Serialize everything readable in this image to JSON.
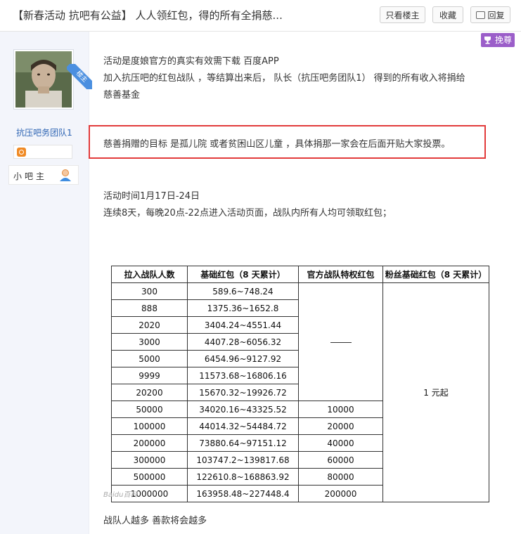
{
  "header": {
    "title": "【新春活动 抗吧有公益】 人人领红包，得的所有全捐慈...",
    "btn_only_op": "只看楼主",
    "btn_favorite": "收藏",
    "btn_reply": "回复"
  },
  "author": {
    "floor_badge": "楼主",
    "username": "抗压吧务团队1",
    "role": "小吧主"
  },
  "post_badge": "挽尊",
  "post": {
    "line1": "活动是度娘官方的真实有效需下载 百度APP",
    "line2": "加入抗压吧的红包战队 ，等结算出来后， 队长（抗压吧务团队1） 得到的所有收入将捐给",
    "line3": "慈善基金",
    "highlight": "慈善捐赠的目标 是孤儿院 或者贫困山区儿童 ，具体捐那一家会在后面开贴大家投票。",
    "time": "活动时间1月17日-24日",
    "rule": "连续8天，每晚20点-22点进入活动页面，战队内所有人均可领取红包；",
    "footer": "战队人越多 善款将会越多"
  },
  "table": {
    "headers": [
      "拉入战队人数",
      "基础红包（8 天累计）",
      "官方战队特权红包",
      "粉丝基础红包（8 天累计）"
    ],
    "rows": [
      [
        "300",
        "589.6~748.24",
        ""
      ],
      [
        "888",
        "1375.36~1652.8",
        ""
      ],
      [
        "2020",
        "3404.24~4551.44",
        ""
      ],
      [
        "3000",
        "4407.28~6056.32",
        ""
      ],
      [
        "5000",
        "6454.96~9127.92",
        ""
      ],
      [
        "9999",
        "11573.68~16806.16",
        ""
      ],
      [
        "20200",
        "15670.32~19926.72",
        ""
      ],
      [
        "50000",
        "34020.16~43325.52",
        "10000"
      ],
      [
        "100000",
        "44014.32~54484.72",
        "20000"
      ],
      [
        "200000",
        "73880.64~97151.12",
        "40000"
      ],
      [
        "300000",
        "103747.2~139817.68",
        "60000"
      ],
      [
        "500000",
        "122610.8~168863.92",
        "80000"
      ],
      [
        "1000000",
        "163958.48~227448.4",
        "200000"
      ]
    ],
    "fan_value": "1 元起"
  },
  "watermark": "Baidu百科"
}
